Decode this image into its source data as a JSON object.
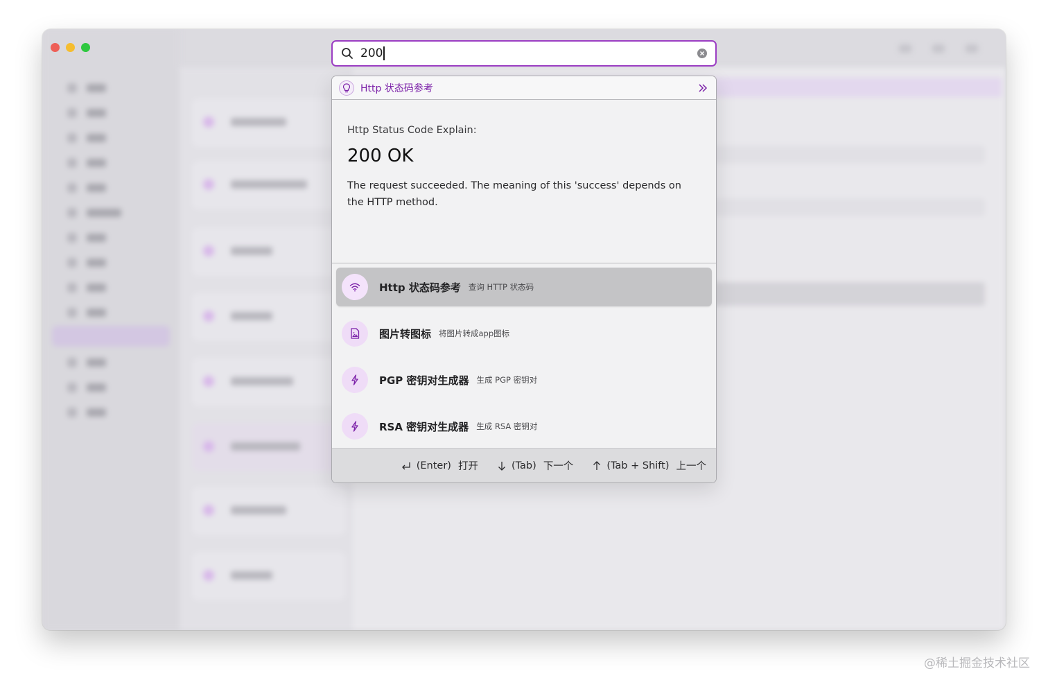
{
  "search": {
    "query": "200"
  },
  "preview": {
    "header_title": "Http 状态码参考",
    "label": "Http Status Code Explain:",
    "code": "200 OK",
    "description": "The request succeeded. The meaning of this 'success' depends on the HTTP method."
  },
  "results": [
    {
      "title": "Http 状态码参考",
      "subtitle": "查询 HTTP 状态码",
      "icon": "wifi-icon",
      "selected": true
    },
    {
      "title": "图片转图标",
      "subtitle": "将图片转成app图标",
      "icon": "file-image-icon",
      "selected": false
    },
    {
      "title": "PGP 密钥对生成器",
      "subtitle": "生成 PGP 密钥对",
      "icon": "lightning-icon",
      "selected": false
    },
    {
      "title": "RSA 密钥对生成器",
      "subtitle": "生成 RSA 密钥对",
      "icon": "lightning-icon",
      "selected": false
    }
  ],
  "footer": {
    "open_key": "(Enter)",
    "open_label": "打开",
    "next_key": "(Tab)",
    "next_label": "下一个",
    "prev_key": "(Tab + Shift)",
    "prev_label": "上一个"
  },
  "watermark": "@稀土掘金技术社区",
  "colors": {
    "accent": "#9b3dc3",
    "accent_text": "#7b20a8",
    "icon_bg": "#efdcf7",
    "selected_row": "#c4c4c6"
  }
}
